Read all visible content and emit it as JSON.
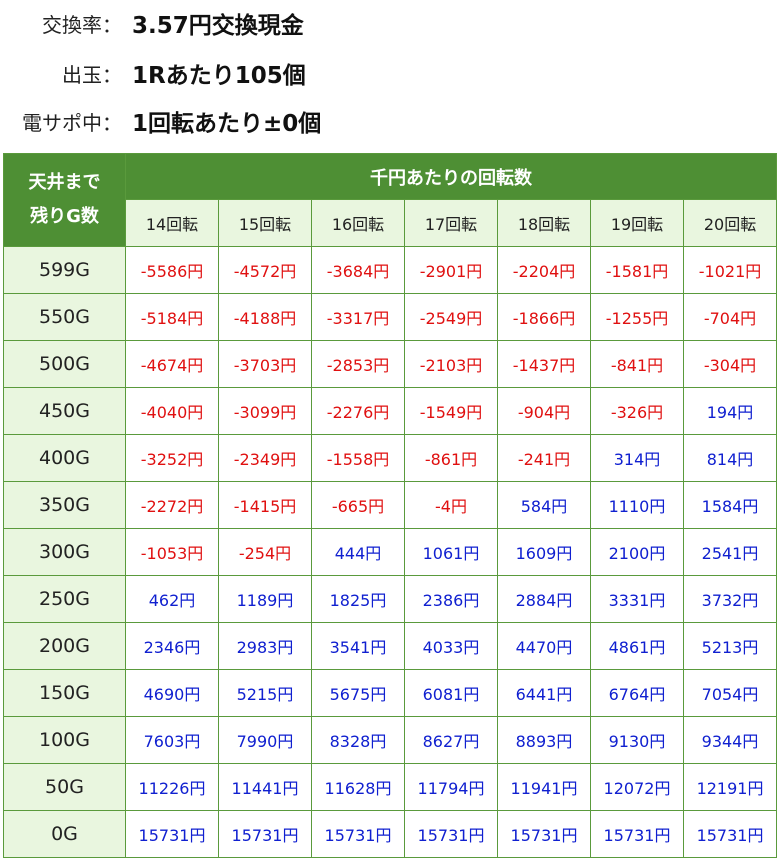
{
  "info": [
    {
      "label": "交換率：",
      "value": "3.57円交換現金"
    },
    {
      "label": "出玉：",
      "value": "1Rあたり105個"
    },
    {
      "label": "電サポ中：",
      "value": "1回転あたり±0個"
    }
  ],
  "table": {
    "corner": [
      "天井まで",
      "残りG数"
    ],
    "group_header": "千円あたりの回転数",
    "columns": [
      "14回転",
      "15回転",
      "16回転",
      "17回転",
      "18回転",
      "19回転",
      "20回転"
    ],
    "rows": [
      {
        "label": "599G",
        "values": [
          "-5586円",
          "-4572円",
          "-3684円",
          "-2901円",
          "-2204円",
          "-1581円",
          "-1021円"
        ]
      },
      {
        "label": "550G",
        "values": [
          "-5184円",
          "-4188円",
          "-3317円",
          "-2549円",
          "-1866円",
          "-1255円",
          "-704円"
        ]
      },
      {
        "label": "500G",
        "values": [
          "-4674円",
          "-3703円",
          "-2853円",
          "-2103円",
          "-1437円",
          "-841円",
          "-304円"
        ]
      },
      {
        "label": "450G",
        "values": [
          "-4040円",
          "-3099円",
          "-2276円",
          "-1549円",
          "-904円",
          "-326円",
          "194円"
        ]
      },
      {
        "label": "400G",
        "values": [
          "-3252円",
          "-2349円",
          "-1558円",
          "-861円",
          "-241円",
          "314円",
          "814円"
        ]
      },
      {
        "label": "350G",
        "values": [
          "-2272円",
          "-1415円",
          "-665円",
          "-4円",
          "584円",
          "1110円",
          "1584円"
        ]
      },
      {
        "label": "300G",
        "values": [
          "-1053円",
          "-254円",
          "444円",
          "1061円",
          "1609円",
          "2100円",
          "2541円"
        ]
      },
      {
        "label": "250G",
        "values": [
          "462円",
          "1189円",
          "1825円",
          "2386円",
          "2884円",
          "3331円",
          "3732円"
        ]
      },
      {
        "label": "200G",
        "values": [
          "2346円",
          "2983円",
          "3541円",
          "4033円",
          "4470円",
          "4861円",
          "5213円"
        ]
      },
      {
        "label": "150G",
        "values": [
          "4690円",
          "5215円",
          "5675円",
          "6081円",
          "6441円",
          "6764円",
          "7054円"
        ]
      },
      {
        "label": "100G",
        "values": [
          "7603円",
          "7990円",
          "8328円",
          "8627円",
          "8893円",
          "9130円",
          "9344円"
        ]
      },
      {
        "label": "50G",
        "values": [
          "11226円",
          "11441円",
          "11628円",
          "11794円",
          "11941円",
          "12072円",
          "12191円"
        ]
      },
      {
        "label": "0G",
        "values": [
          "15731円",
          "15731円",
          "15731円",
          "15731円",
          "15731円",
          "15731円",
          "15731円"
        ]
      }
    ]
  },
  "colors": {
    "header_green": "#4e8f34",
    "light_green": "#e9f6df",
    "negative_red": "#e01010",
    "positive_blue": "#1020d0"
  }
}
